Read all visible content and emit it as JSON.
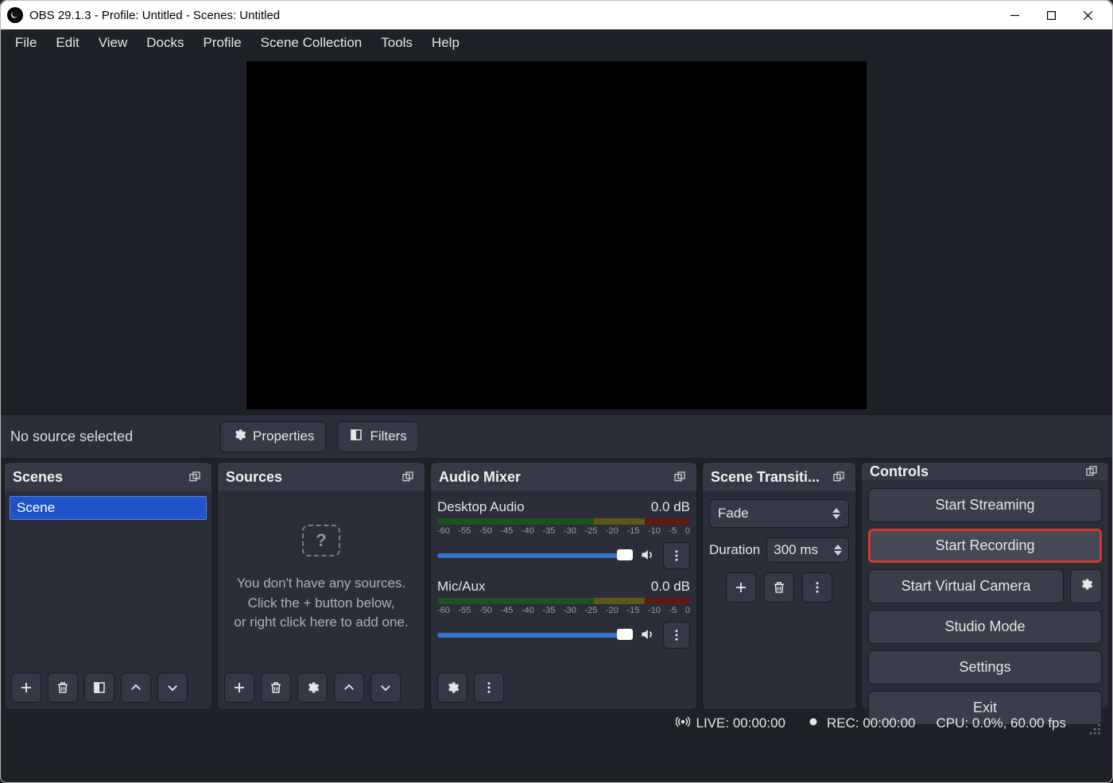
{
  "titlebar": {
    "title": "OBS 29.1.3 - Profile: Untitled - Scenes: Untitled"
  },
  "menubar": {
    "items": [
      "File",
      "Edit",
      "View",
      "Docks",
      "Profile",
      "Scene Collection",
      "Tools",
      "Help"
    ]
  },
  "source_bar": {
    "status": "No source selected",
    "properties_label": "Properties",
    "filters_label": "Filters"
  },
  "panels": {
    "scenes": {
      "title": "Scenes",
      "items": [
        "Scene"
      ]
    },
    "sources": {
      "title": "Sources",
      "placeholder_line1": "You don't have any sources.",
      "placeholder_line2": "Click the + button below,",
      "placeholder_line3": "or right click here to add one."
    },
    "mixer": {
      "title": "Audio Mixer",
      "ticks": [
        "-60",
        "-55",
        "-50",
        "-45",
        "-40",
        "-35",
        "-30",
        "-25",
        "-20",
        "-15",
        "-10",
        "-5",
        "0"
      ],
      "channels": [
        {
          "name": "Desktop Audio",
          "level": "0.0 dB"
        },
        {
          "name": "Mic/Aux",
          "level": "0.0 dB"
        }
      ]
    },
    "transitions": {
      "title": "Scene Transiti...",
      "selected": "Fade",
      "duration_label": "Duration",
      "duration_value": "300 ms"
    },
    "controls": {
      "title": "Controls",
      "start_streaming": "Start Streaming",
      "start_recording": "Start Recording",
      "start_vcam": "Start Virtual Camera",
      "studio_mode": "Studio Mode",
      "settings": "Settings",
      "exit": "Exit"
    }
  },
  "statusbar": {
    "live": "LIVE: 00:00:00",
    "rec": "REC: 00:00:00",
    "cpu": "CPU: 0.0%, 60.00 fps"
  }
}
